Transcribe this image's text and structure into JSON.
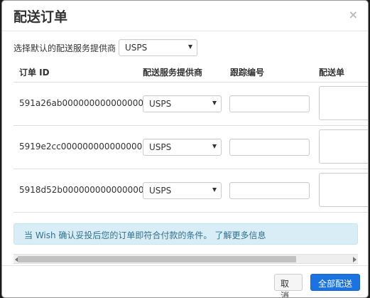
{
  "modal": {
    "title": "配送订单",
    "close": "×"
  },
  "default_provider": {
    "label": "选择默认的配送服务提供商",
    "value": "USPS"
  },
  "table": {
    "headers": {
      "order_id": "订单 ID",
      "provider": "配送服务提供商",
      "tracking": "跟踪编号",
      "slip": "配送单"
    },
    "rows": [
      {
        "order_id": "591a26ab0000000000000000",
        "provider": "USPS",
        "tracking": ""
      },
      {
        "order_id": "5919e2cc0000000000000000",
        "provider": "USPS",
        "tracking": ""
      },
      {
        "order_id": "5918d52b0000000000000000",
        "provider": "USPS",
        "tracking": ""
      }
    ]
  },
  "info": {
    "text": "当 Wish 确认妥投后您的订单即符合付款的条件。",
    "link": "了解更多信息"
  },
  "footer": {
    "cancel": "取消",
    "ship_all": "全部配送"
  },
  "colors": {
    "primary": "#1a73e0",
    "info_bg": "#d9edf7",
    "info_text": "#31708f"
  }
}
